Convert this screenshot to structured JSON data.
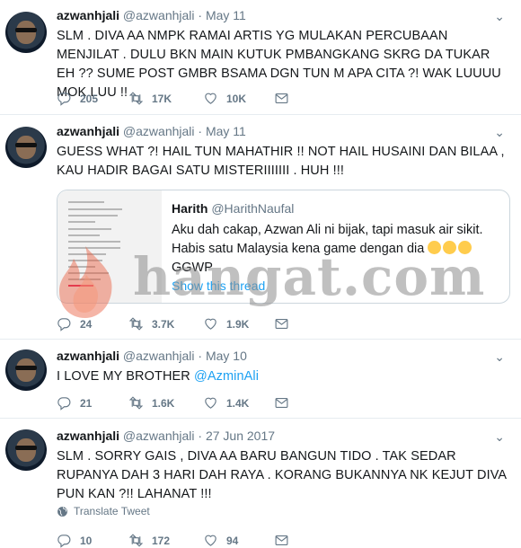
{
  "tweets": [
    {
      "name": "azwanhjali",
      "handle": "@azwanhjali",
      "sep": "·",
      "date": "May 11",
      "text": "SLM . DIVA AA NMPK RAMAI ARTIS YG MULAKAN PERCUBAAN MENJILAT . DULU BKN MAIN KUTUK PMBANGKANG SKRG DA TUKAR EH ?? SUME POST GMBR BSAMA DGN TUN M APA CITA ?! WAK LUUUU MOK LUU !!",
      "replies": "205",
      "retweets": "17K",
      "likes": "10K"
    },
    {
      "name": "azwanhjali",
      "handle": "@azwanhjali",
      "sep": "·",
      "date": "May 11",
      "text": "GUESS WHAT ?! HAIL TUN MAHATHIR !! NOT HAIL HUSAINI DAN BILAA , KAU HADIR BAGAI SATU MISTERIIIIIII . HUH !!!",
      "replies": "24",
      "retweets": "3.7K",
      "likes": "1.9K",
      "quote": {
        "name": "Harith",
        "handle": "@HarithNaufal",
        "text": "Aku dah cakap, Azwan Ali ni bijak, tapi masuk air sikit. Habis satu Malaysia kena game dengan dia",
        "tail": "GGWP",
        "show_thread": "Show this thread"
      }
    },
    {
      "name": "azwanhjali",
      "handle": "@azwanhjali",
      "sep": "·",
      "date": "May 10",
      "text_prefix": "I LOVE MY BROTHER ",
      "mention": "@AzminAli",
      "replies": "21",
      "retweets": "1.6K",
      "likes": "1.4K"
    },
    {
      "name": "azwanhjali",
      "handle": "@azwanhjali",
      "sep": "·",
      "date": "27 Jun 2017",
      "text": "SLM . SORRY GAIS , DIVA AA BARU BANGUN TIDO . TAK SEDAR RUPANYA DAH 3 HARI DAH RAYA . KORANG BUKANNYA NK KEJUT DIVA PUN KAN ?!! LAHANAT !!!",
      "translate": "Translate Tweet",
      "replies": "10",
      "retweets": "172",
      "likes": "94"
    }
  ],
  "watermark": "hangat.com",
  "icons": {
    "reply": "reply-icon",
    "retweet": "retweet-icon",
    "like": "heart-icon",
    "share": "message-icon",
    "more": "chevron-down-icon",
    "globe": "globe-icon"
  },
  "colors": {
    "link": "#1da1f2",
    "muted": "#657786",
    "text": "#14171a",
    "border": "#e6ecf0"
  }
}
